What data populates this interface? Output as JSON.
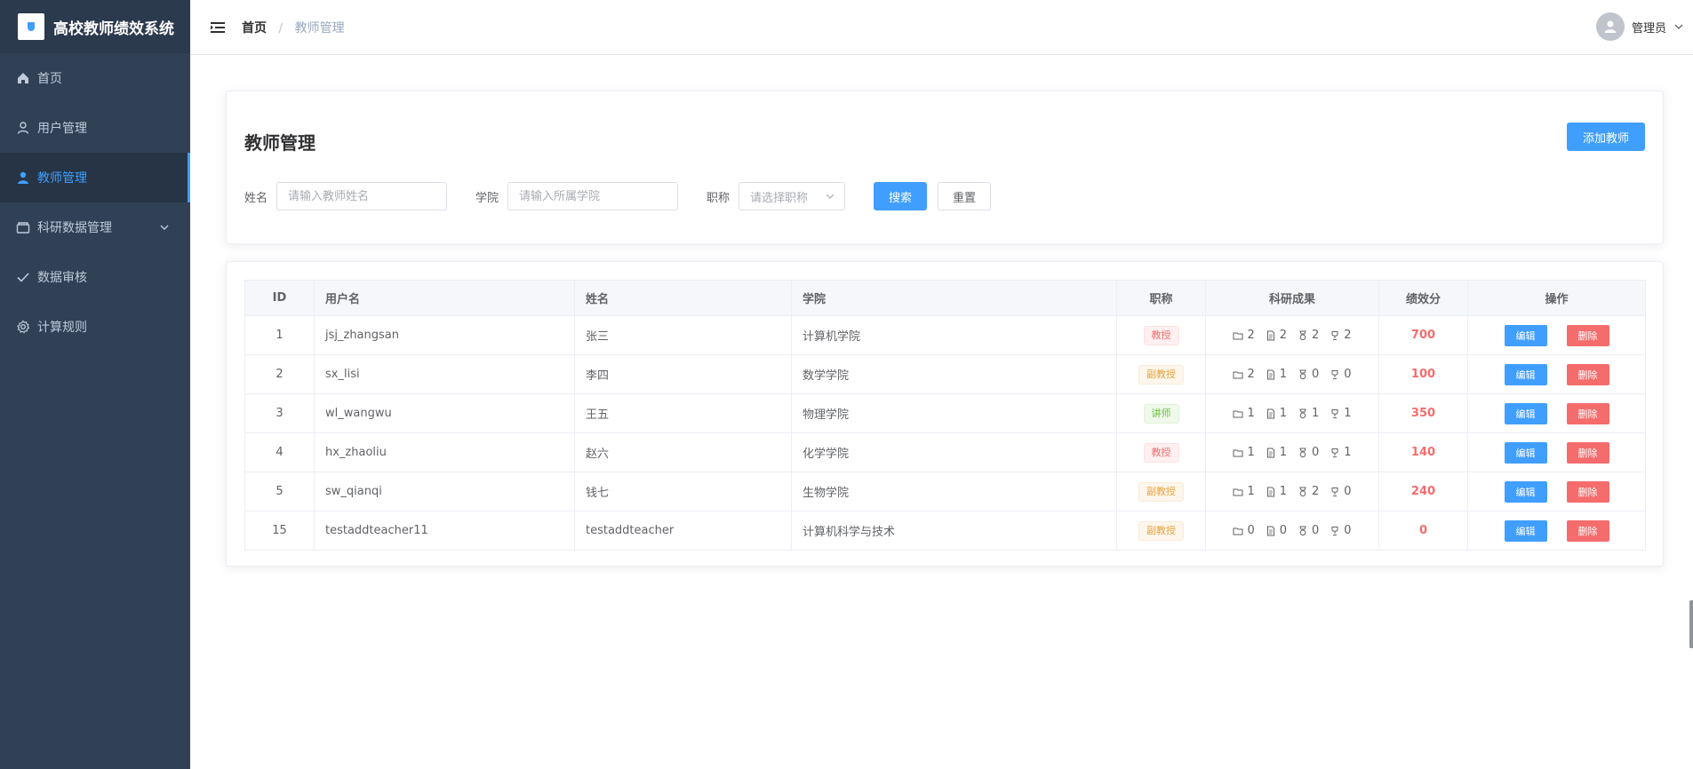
{
  "app": {
    "brand_title": "高校教师绩效系统"
  },
  "sidebar": {
    "items": [
      {
        "label": "首页",
        "icon": "home-icon"
      },
      {
        "label": "用户管理",
        "icon": "user-icon"
      },
      {
        "label": "教师管理",
        "icon": "teacher-icon",
        "active": true
      },
      {
        "label": "科研数据管理",
        "icon": "folder-icon",
        "has_submenu": true
      },
      {
        "label": "数据审核",
        "icon": "check-icon"
      },
      {
        "label": "计算规则",
        "icon": "gear-icon"
      }
    ]
  },
  "header": {
    "breadcrumb_home": "首页",
    "breadcrumb_sep": "/",
    "breadcrumb_current": "教师管理",
    "user_name": "管理员"
  },
  "page": {
    "title": "教师管理",
    "add_button": "添加教师"
  },
  "filters": {
    "name_label": "姓名",
    "name_placeholder": "请输入教师姓名",
    "college_label": "学院",
    "college_placeholder": "请输入所属学院",
    "title_label": "职称",
    "title_placeholder": "请选择职称",
    "search_button": "搜索",
    "reset_button": "重置"
  },
  "table": {
    "headers": {
      "id": "ID",
      "username": "用户名",
      "name": "姓名",
      "college": "学院",
      "title": "职称",
      "research": "科研成果",
      "score": "绩效分",
      "ops": "操作"
    },
    "edit_label": "编辑",
    "delete_label": "删除",
    "rows": [
      {
        "id": "1",
        "username": "jsj_zhangsan",
        "name": "张三",
        "college": "计算机学院",
        "title": "教授",
        "title_type": "danger",
        "projects": "2",
        "papers": "2",
        "awards": "2",
        "trophies": "2",
        "score": "700"
      },
      {
        "id": "2",
        "username": "sx_lisi",
        "name": "李四",
        "college": "数学学院",
        "title": "副教授",
        "title_type": "warning",
        "projects": "2",
        "papers": "1",
        "awards": "0",
        "trophies": "0",
        "score": "100"
      },
      {
        "id": "3",
        "username": "wl_wangwu",
        "name": "王五",
        "college": "物理学院",
        "title": "讲师",
        "title_type": "success",
        "projects": "1",
        "papers": "1",
        "awards": "1",
        "trophies": "1",
        "score": "350"
      },
      {
        "id": "4",
        "username": "hx_zhaoliu",
        "name": "赵六",
        "college": "化学学院",
        "title": "教授",
        "title_type": "danger",
        "projects": "1",
        "papers": "1",
        "awards": "0",
        "trophies": "1",
        "score": "140"
      },
      {
        "id": "5",
        "username": "sw_qianqi",
        "name": "钱七",
        "college": "生物学院",
        "title": "副教授",
        "title_type": "warning",
        "projects": "1",
        "papers": "1",
        "awards": "2",
        "trophies": "0",
        "score": "240"
      },
      {
        "id": "15",
        "username": "testaddteacher11",
        "name": "testaddteacher",
        "college": "计算机科学与技术",
        "title": "副教授",
        "title_type": "warning",
        "projects": "0",
        "papers": "0",
        "awards": "0",
        "trophies": "0",
        "score": "0"
      }
    ]
  },
  "colors": {
    "sidebar_bg": "#304156",
    "accent": "#409eff",
    "danger": "#f56c6c",
    "warning": "#e6a23c",
    "success": "#67c23a"
  }
}
